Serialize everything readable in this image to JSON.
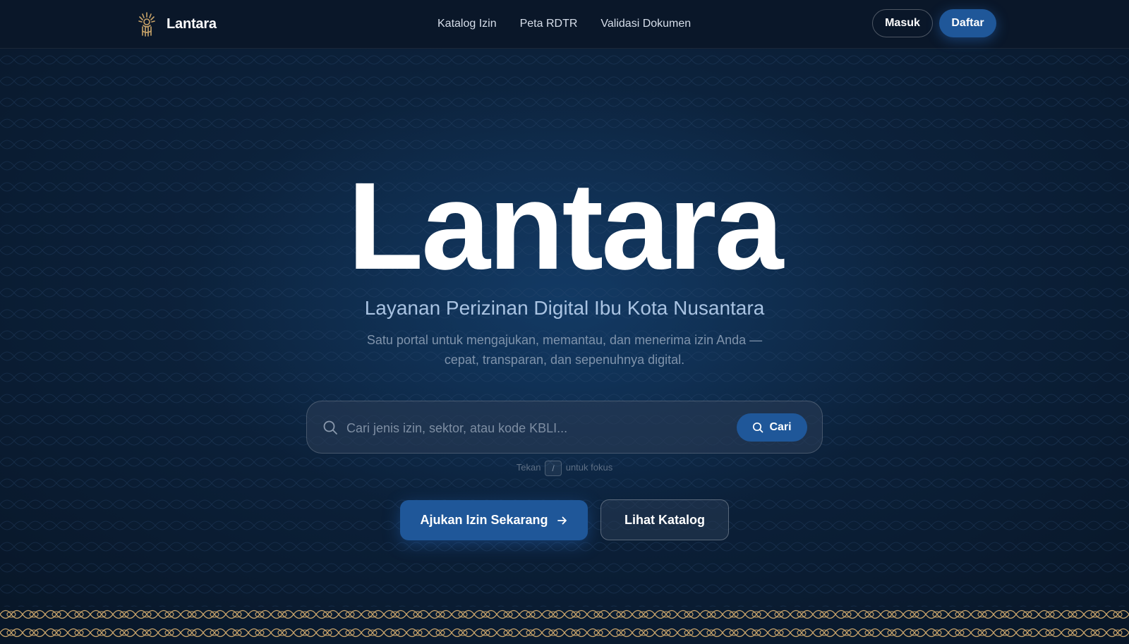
{
  "navbar": {
    "brand_name": "Lantara",
    "links": [
      {
        "label": "Katalog Izin"
      },
      {
        "label": "Peta RDTR"
      },
      {
        "label": "Validasi Dokumen"
      }
    ],
    "login_label": "Masuk",
    "register_label": "Daftar"
  },
  "hero": {
    "title": "Lantara",
    "subtitle": "Layanan Perizinan Digital Ibu Kota Nusantara",
    "description": "Satu portal untuk mengajukan, memantau, dan menerima izin Anda — cepat, transparan, dan sepenuhnya digital."
  },
  "search": {
    "placeholder": "Cari jenis izin, sektor, atau kode KBLI...",
    "value": "",
    "button_label": "Cari",
    "hint_prefix": "Tekan",
    "hint_key": "/",
    "hint_suffix": "untuk fokus"
  },
  "cta": {
    "primary_label": "Ajukan Izin Sekarang",
    "secondary_label": "Lihat Katalog"
  },
  "colors": {
    "background": "#0a1a2e",
    "navbar": "#0a1729",
    "accent": "#1f5799",
    "subtitle": "#a9c3e2",
    "ornament_gold": "#c9a46a"
  },
  "icons": {
    "brand": "lantara-logo-icon",
    "search": "search-icon",
    "arrow": "arrow-right-icon"
  }
}
